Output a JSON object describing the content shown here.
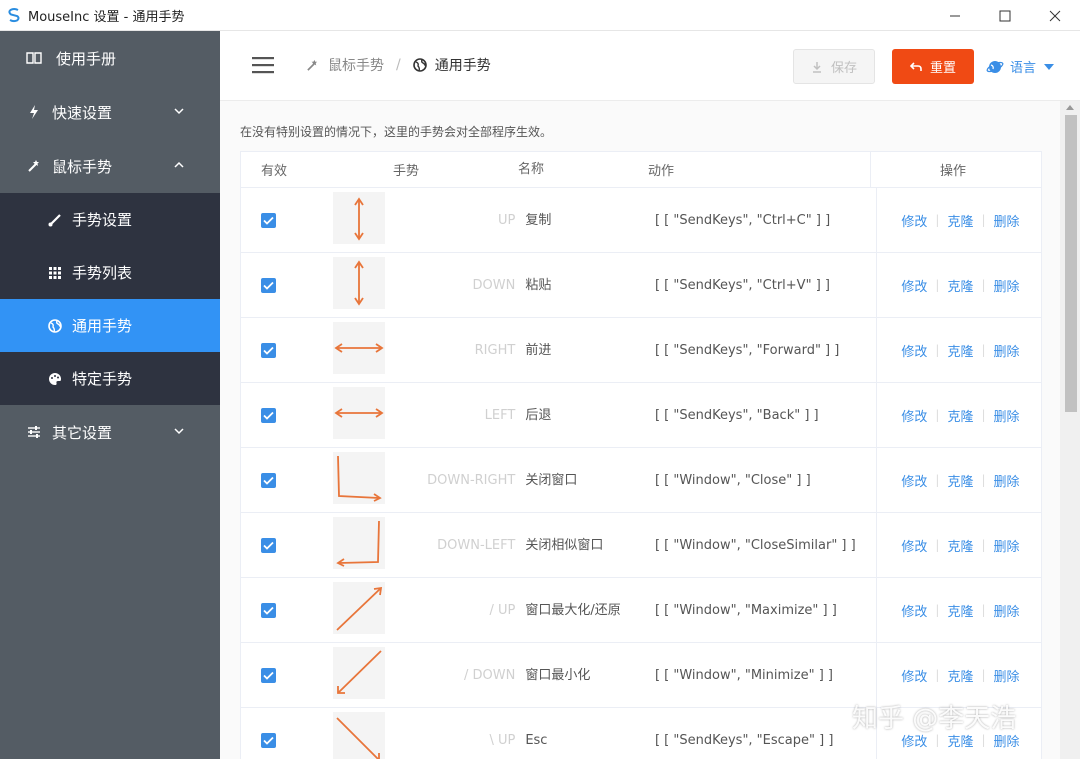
{
  "window": {
    "title": "MouseInc 设置 - 通用手势"
  },
  "colors": {
    "sidebar_bg": "#545c64",
    "submenu_bg": "#2e3340",
    "active": "#3293f5",
    "accent_red": "#f04a14",
    "link_blue": "#3a8ee6",
    "gesture_arrow": "#e8753a"
  },
  "sidebar": {
    "items": [
      {
        "label": "使用手册",
        "icon": "book-icon"
      },
      {
        "label": "快速设置",
        "icon": "lightning-icon",
        "expanded": false
      },
      {
        "label": "鼠标手势",
        "icon": "magic-wand-icon",
        "expanded": true
      },
      {
        "label": "其它设置",
        "icon": "sliders-icon",
        "expanded": false
      }
    ],
    "sub_items": [
      {
        "label": "手势设置",
        "icon": "brush-icon"
      },
      {
        "label": "手势列表",
        "icon": "grid-icon"
      },
      {
        "label": "通用手势",
        "icon": "globe-icon",
        "active": true
      },
      {
        "label": "特定手势",
        "icon": "palette-icon"
      }
    ]
  },
  "header": {
    "breadcrumb": [
      "鼠标手势",
      "通用手势"
    ],
    "breadcrumb_sep": "/",
    "save_label": "保存",
    "reset_label": "重置",
    "language_label": "语言"
  },
  "main": {
    "description": "在没有特别设置的情况下，这里的手势会对全部程序生效。",
    "columns": [
      "有效",
      "手势",
      "名称",
      "动作",
      "操作"
    ],
    "ops": {
      "edit": "修改",
      "clone": "克隆",
      "delete": "删除",
      "sep": "|"
    },
    "rows": [
      {
        "enabled": true,
        "gesture": "UP",
        "name": "复制",
        "action": "[ [ \"SendKeys\", \"Ctrl+C\" ] ]"
      },
      {
        "enabled": true,
        "gesture": "DOWN",
        "name": "粘贴",
        "action": "[ [ \"SendKeys\", \"Ctrl+V\" ] ]"
      },
      {
        "enabled": true,
        "gesture": "RIGHT",
        "name": "前进",
        "action": "[ [ \"SendKeys\", \"Forward\" ] ]"
      },
      {
        "enabled": true,
        "gesture": "LEFT",
        "name": "后退",
        "action": "[ [ \"SendKeys\", \"Back\" ] ]"
      },
      {
        "enabled": true,
        "gesture": "DOWN-RIGHT",
        "name": "关闭窗口",
        "action": "[ [ \"Window\", \"Close\" ] ]"
      },
      {
        "enabled": true,
        "gesture": "DOWN-LEFT",
        "name": "关闭相似窗口",
        "action": "[ [ \"Window\", \"CloseSimilar\" ] ]"
      },
      {
        "enabled": true,
        "gesture": "/ UP",
        "name": "窗口最大化/还原",
        "action": "[ [ \"Window\", \"Maximize\" ] ]"
      },
      {
        "enabled": true,
        "gesture": "/ DOWN",
        "name": "窗口最小化",
        "action": "[ [ \"Window\", \"Minimize\" ] ]"
      },
      {
        "enabled": true,
        "gesture": "\\ UP",
        "name": "Esc",
        "action": "[ [ \"SendKeys\", \"Escape\" ] ]"
      }
    ]
  },
  "watermark": "知乎 @李天浩"
}
